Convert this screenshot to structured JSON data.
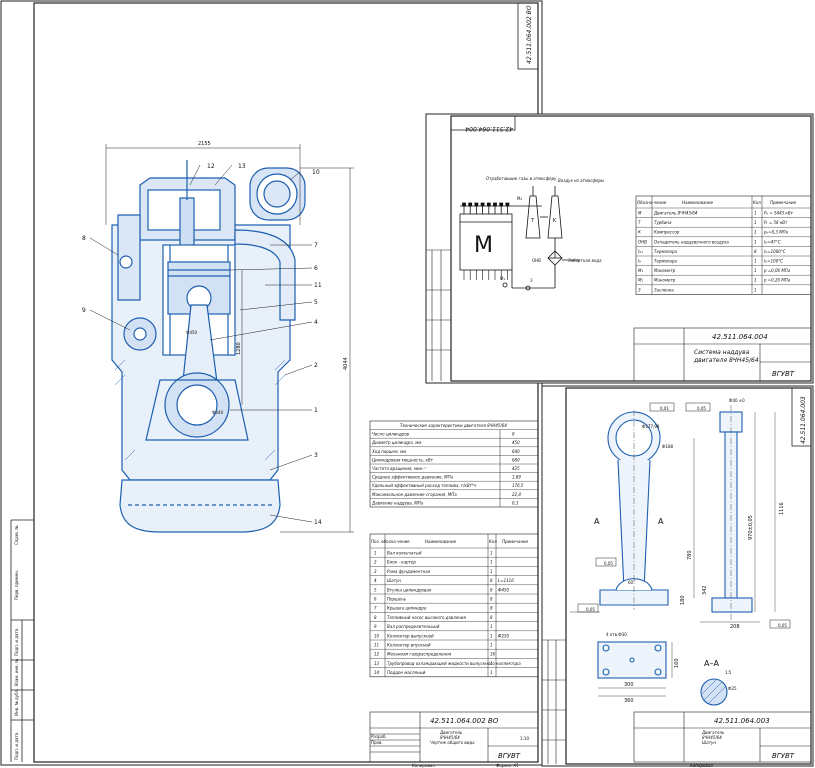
{
  "engine_sheet": {
    "code": "42.511.064.002 ВО",
    "code_rotated": "42.511.064.002 ВО",
    "title_line1": "Двигатель",
    "title_line2": "8ЧН45/64",
    "title_line3": "Чертеж общего вида",
    "school": "ВГУВТ",
    "sheet_scale": "1:10",
    "dims": {
      "width": "2155",
      "height": "4044",
      "stroke": "1280",
      "bore": "Ф450",
      "crank": "Ф640"
    },
    "callouts": [
      "1",
      "2",
      "3",
      "4",
      "5",
      "6",
      "7",
      "8",
      "9",
      "10",
      "11",
      "12",
      "13",
      "14"
    ]
  },
  "tech_table": {
    "title": "Технические характеристики двигателя 8ЧН45/64",
    "rows": [
      {
        "name": "Число цилиндров",
        "value": "8"
      },
      {
        "name": "Диаметр цилиндра, мм",
        "value": "450"
      },
      {
        "name": "Ход поршня, мм",
        "value": "640"
      },
      {
        "name": "Цилиндровая мощность, кВт",
        "value": "680"
      },
      {
        "name": "Частота вращения, мин⁻¹",
        "value": "425"
      },
      {
        "name": "Среднее эффективное давление, МПа",
        "value": "1,89"
      },
      {
        "name": "Удельный эффективный расход топлива, г/кВт*ч",
        "value": "176,5"
      },
      {
        "name": "Максимальное давление сгорания, МПа",
        "value": "22,4"
      },
      {
        "name": "Давление наддува, МПа",
        "value": "0,3"
      }
    ]
  },
  "parts_table": {
    "headers": [
      "Поз. обозна-чение",
      "Наименование",
      "Кол",
      "Примечание"
    ],
    "rows": [
      {
        "pos": "1",
        "name": "Вал коленчатый",
        "qty": "1",
        "note": ""
      },
      {
        "pos": "2",
        "name": "Блок - картер",
        "qty": "1",
        "note": ""
      },
      {
        "pos": "3",
        "name": "Рама фундаментная",
        "qty": "1",
        "note": ""
      },
      {
        "pos": "4",
        "name": "Шатун",
        "qty": "8",
        "note": "L=1116"
      },
      {
        "pos": "5",
        "name": "Втулка цилиндровая",
        "qty": "8",
        "note": "Ф450"
      },
      {
        "pos": "6",
        "name": "Поршень",
        "qty": "8",
        "note": ""
      },
      {
        "pos": "7",
        "name": "Крышка цилиндра",
        "qty": "8",
        "note": ""
      },
      {
        "pos": "8",
        "name": "Топливный насос высокого давления",
        "qty": "8",
        "note": ""
      },
      {
        "pos": "9",
        "name": "Вал распределительный",
        "qty": "1",
        "note": ""
      },
      {
        "pos": "10",
        "name": "Коллектор выпускной",
        "qty": "1",
        "note": "Ф250"
      },
      {
        "pos": "11",
        "name": "Коллектор впускной",
        "qty": "1",
        "note": ""
      },
      {
        "pos": "12",
        "name": "Механизм газораспределения",
        "qty": "16",
        "note": ""
      },
      {
        "pos": "13",
        "name": "Трубопровод охлаждающей жидкости выпускного коллектора",
        "qty": "1",
        "note": ""
      },
      {
        "pos": "14",
        "name": "Поддон масляный",
        "qty": "1",
        "note": ""
      }
    ]
  },
  "system_sheet": {
    "code": "42.511.064.004",
    "code_rotated": "42.511.064.004",
    "title_line1": "Система наддува",
    "title_line2": "двигателя 8ЧН45/64",
    "school": "ВГУВТ",
    "block_M": "M",
    "label_exhaust": "Отработавшие газы в атмосферу",
    "label_air": "Воздух из атмосферы",
    "label_water": "Забортная вода",
    "marks": {
      "T": "T",
      "K": "K",
      "OHB": "ОНВ",
      "M1": "M₁",
      "M2": "M₂",
      "t1": "tн",
      "t2": "tк",
      "Z": "З"
    },
    "headers": [
      "Обозна-чение",
      "Наименование",
      "Кол",
      "Примечание"
    ],
    "rows": [
      {
        "sym": "М",
        "name": "Двигатель 8ЧН45/64",
        "qty": "1",
        "note": "Pₑ = 5443 кВт"
      },
      {
        "sym": "Т",
        "name": "Турбина",
        "qty": "1",
        "note": "Pₜ = 58 кВт"
      },
      {
        "sym": "К",
        "name": "Компрессор",
        "qty": "1",
        "note": "pₖ=0,3 МПа"
      },
      {
        "sym": "ОНВ",
        "name": "Охладитель наддувочного воздуха",
        "qty": "1",
        "note": "tₖ=47°С"
      },
      {
        "sym": "tₚ₁",
        "name": "Термопара",
        "qty": "8",
        "note": "tₚ=1000°С"
      },
      {
        "sym": "tₖ",
        "name": "Термопара",
        "qty": "1",
        "note": "tₖ=100°С"
      },
      {
        "sym": "M₁",
        "name": "Манометр",
        "qty": "1",
        "note": "p =0,06 МПа"
      },
      {
        "sym": "M₂",
        "name": "Манометр",
        "qty": "1",
        "note": "p =0,20 МПа"
      },
      {
        "sym": "З",
        "name": "Заслонка",
        "qty": "1",
        "note": ""
      }
    ]
  },
  "rod_sheet": {
    "code": "42.511.064.003",
    "code_rotated": "42.511.064.003",
    "title_line1": "Двигатель",
    "title_line2": "8ЧН45/64",
    "title_line3": "Шатун",
    "school": "ВГУВТ",
    "section_label": "А–А",
    "section_A": "А",
    "scale": "1:5",
    "dims": {
      "length": "1116",
      "d_small": "Ф177,98",
      "r_small": "Ф188",
      "d_big": "Ф40 ±0",
      "l1": "970±0,05",
      "l2": "780",
      "l3": "342",
      "l4": "180",
      "l5": "208",
      "w1": "300",
      "w2": "360",
      "h1": "160",
      "angle": "60°",
      "holes": "4 отв.Ф30",
      "r25": "Ф25"
    },
    "tolerances": [
      "0,01",
      "0,05",
      "0,05",
      "0,05",
      "0,05",
      "0,05"
    ]
  },
  "frame": {
    "stamp_labels": [
      "Изм.",
      "Лист",
      "№ докум.",
      "Подп.",
      "Дата",
      "Разраб.",
      "Пров.",
      "Н.контр.",
      "Утв."
    ],
    "footer": "Копировал",
    "format": "Формат А1",
    "side_labels": [
      "Подп. и дата",
      "Инв. № дубл.",
      "Взам. инв. №",
      "Подп. и дата",
      "Инв. № подл."
    ],
    "left_labels": [
      "Перв. примен.",
      "Справ. №"
    ]
  }
}
